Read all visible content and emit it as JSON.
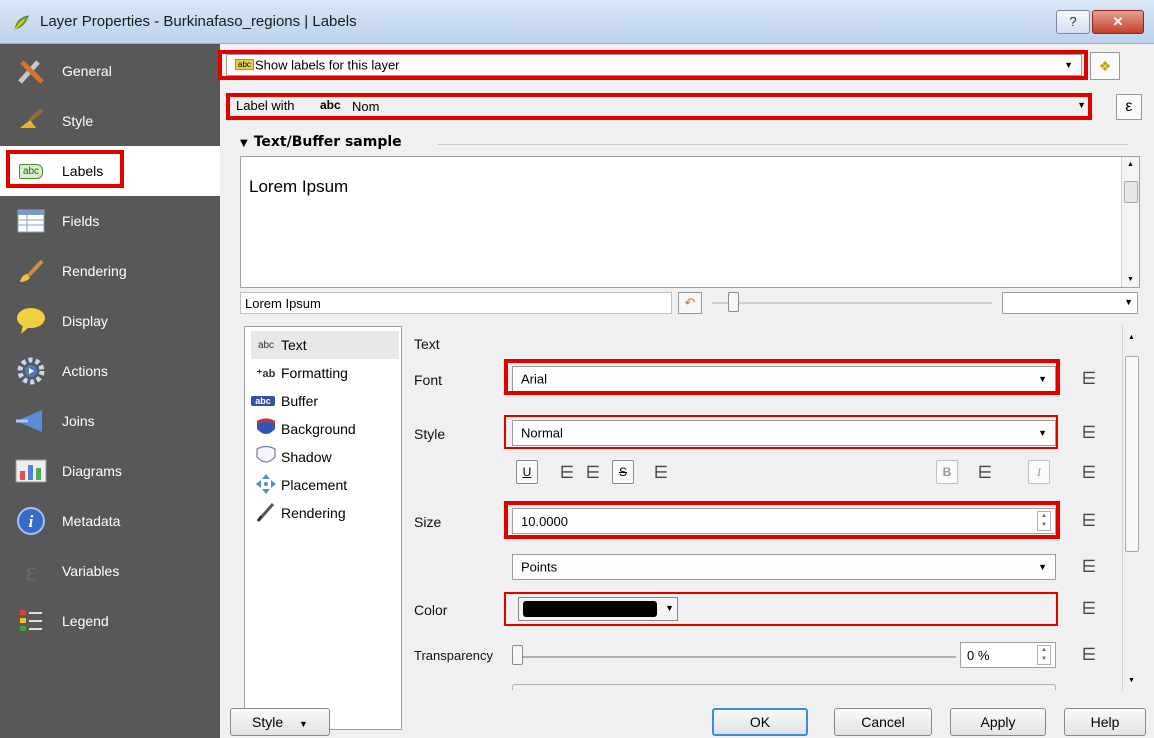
{
  "window": {
    "title": "Layer Properties - Burkinafaso_regions | Labels",
    "help_label": "?",
    "close_label": "✕"
  },
  "sidebar": {
    "items": [
      {
        "label": "General",
        "icon": "general-icon"
      },
      {
        "label": "Style",
        "icon": "style-brush-icon"
      },
      {
        "label": "Labels",
        "icon": "labels-abc-icon",
        "badge": "abc"
      },
      {
        "label": "Fields",
        "icon": "fields-table-icon"
      },
      {
        "label": "Rendering",
        "icon": "rendering-brush-icon"
      },
      {
        "label": "Display",
        "icon": "display-speech-icon"
      },
      {
        "label": "Actions",
        "icon": "actions-gear-icon"
      },
      {
        "label": "Joins",
        "icon": "joins-arrow-icon"
      },
      {
        "label": "Diagrams",
        "icon": "diagrams-chart-icon"
      },
      {
        "label": "Metadata",
        "icon": "metadata-info-icon"
      },
      {
        "label": "Variables",
        "icon": "variables-epsilon-icon"
      },
      {
        "label": "Legend",
        "icon": "legend-list-icon"
      }
    ]
  },
  "labeling": {
    "mode_label": "Show labels for this layer",
    "label_with_prefix": "Label with",
    "field_type": "abc",
    "field_name": "Nom",
    "expression_label": "ε"
  },
  "sample": {
    "section_title": "Text/Buffer sample",
    "preview_text": "Lorem Ipsum",
    "sample_input": "Lorem Ipsum"
  },
  "tree": {
    "items": [
      {
        "label": "Text",
        "icon": "abc"
      },
      {
        "label": "Formatting",
        "icon": "+ab"
      },
      {
        "label": "Buffer",
        "icon": "abc"
      },
      {
        "label": "Background",
        "icon": "bg"
      },
      {
        "label": "Shadow",
        "icon": "sh"
      },
      {
        "label": "Placement",
        "icon": "pl"
      },
      {
        "label": "Rendering",
        "icon": "rd"
      }
    ]
  },
  "text_panel": {
    "heading": "Text",
    "font_label": "Font",
    "font_value": "Arial",
    "style_label": "Style",
    "style_value": "Normal",
    "underline": "U",
    "strikeout": "S",
    "bold": "B",
    "italic": "I",
    "size_label": "Size",
    "size_value": "10.0000",
    "unit_value": "Points",
    "color_label": "Color",
    "color_value": "#000000",
    "transparency_label": "Transparency",
    "transparency_value": "0 %"
  },
  "footer": {
    "style_button": "Style",
    "ok": "OK",
    "cancel": "Cancel",
    "apply": "Apply",
    "help": "Help"
  }
}
